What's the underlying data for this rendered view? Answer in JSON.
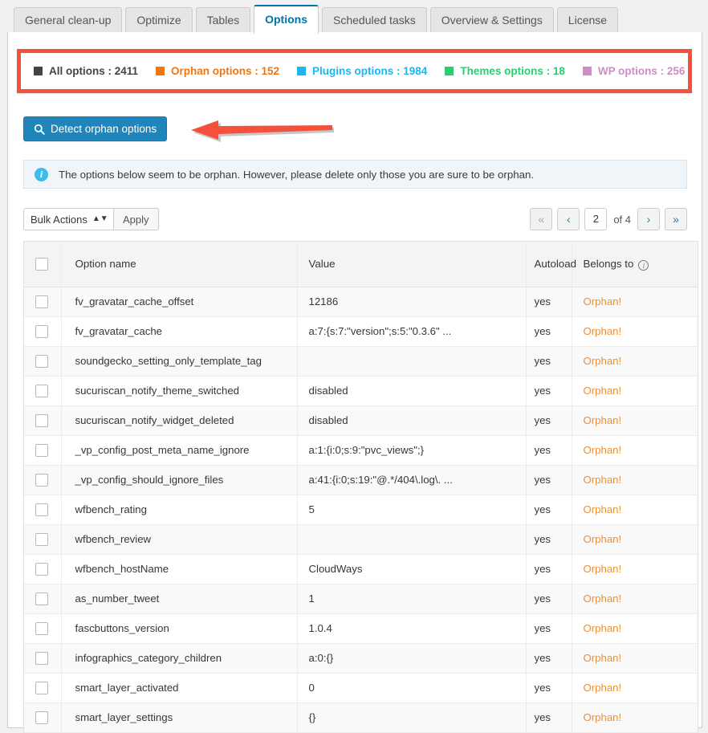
{
  "tabs": [
    {
      "label": "General clean-up",
      "active": false
    },
    {
      "label": "Optimize",
      "active": false
    },
    {
      "label": "Tables",
      "active": false
    },
    {
      "label": "Options",
      "active": true
    },
    {
      "label": "Scheduled tasks",
      "active": false
    },
    {
      "label": "Overview & Settings",
      "active": false
    },
    {
      "label": "License",
      "active": false
    }
  ],
  "legend": {
    "items": [
      {
        "label": "All options : 2411",
        "color": "#444444"
      },
      {
        "label": "Orphan options : 152",
        "color": "#f07613"
      },
      {
        "label": "Plugins options : 1984",
        "color": "#1eb5f0"
      },
      {
        "label": "Themes options : 18",
        "color": "#2ecc71"
      },
      {
        "label": "WP options : 256",
        "color": "#cc8fc1"
      }
    ],
    "highlight_color": "#f4513d"
  },
  "detect_button": {
    "label": "Detect orphan options",
    "icon": "search-icon",
    "color": "#1f85ba"
  },
  "annotation_arrow": {
    "color": "#f4513d",
    "direction": "left"
  },
  "notice": {
    "icon": "info-icon",
    "text": "The options below seem to be orphan. However, please delete only those you are sure to be orphan."
  },
  "toolbar": {
    "bulk_actions_label": "Bulk Actions",
    "apply_label": "Apply",
    "pager": {
      "first_label": "«",
      "prev_label": "‹",
      "current_page": "2",
      "total_label": "of 4",
      "next_label": "›",
      "last_label": "»"
    }
  },
  "table": {
    "headers": {
      "select_all": "select-all-checkbox",
      "option_name": "Option name",
      "value": "Value",
      "autoload": "Autoload",
      "belongs_to": "Belongs to"
    },
    "rows": [
      {
        "name": "fv_gravatar_cache_offset",
        "value": "12186",
        "autoload": "yes",
        "belongs": "Orphan!"
      },
      {
        "name": "fv_gravatar_cache",
        "value": "a:7:{s:7:\"version\";s:5:\"0.3.6\" ...",
        "autoload": "yes",
        "belongs": "Orphan!"
      },
      {
        "name": "soundgecko_setting_only_template_tag",
        "value": "",
        "autoload": "yes",
        "belongs": "Orphan!"
      },
      {
        "name": "sucuriscan_notify_theme_switched",
        "value": "disabled",
        "autoload": "yes",
        "belongs": "Orphan!"
      },
      {
        "name": "sucuriscan_notify_widget_deleted",
        "value": "disabled",
        "autoload": "yes",
        "belongs": "Orphan!"
      },
      {
        "name": "_vp_config_post_meta_name_ignore",
        "value": "a:1:{i:0;s:9:\"pvc_views\";}",
        "autoload": "yes",
        "belongs": "Orphan!"
      },
      {
        "name": "_vp_config_should_ignore_files",
        "value": "a:41:{i:0;s:19:\"@.*/404\\.log\\. ...",
        "autoload": "yes",
        "belongs": "Orphan!"
      },
      {
        "name": "wfbench_rating",
        "value": "5",
        "autoload": "yes",
        "belongs": "Orphan!"
      },
      {
        "name": "wfbench_review",
        "value": "",
        "autoload": "yes",
        "belongs": "Orphan!"
      },
      {
        "name": "wfbench_hostName",
        "value": "CloudWays",
        "autoload": "yes",
        "belongs": "Orphan!"
      },
      {
        "name": "as_number_tweet",
        "value": "1",
        "autoload": "yes",
        "belongs": "Orphan!"
      },
      {
        "name": "fascbuttons_version",
        "value": "1.0.4",
        "autoload": "yes",
        "belongs": "Orphan!"
      },
      {
        "name": "infographics_category_children",
        "value": "a:0:{}",
        "autoload": "yes",
        "belongs": "Orphan!"
      },
      {
        "name": "smart_layer_activated",
        "value": "0",
        "autoload": "yes",
        "belongs": "Orphan!"
      },
      {
        "name": "smart_layer_settings",
        "value": "{}",
        "autoload": "yes",
        "belongs": "Orphan!"
      }
    ]
  }
}
